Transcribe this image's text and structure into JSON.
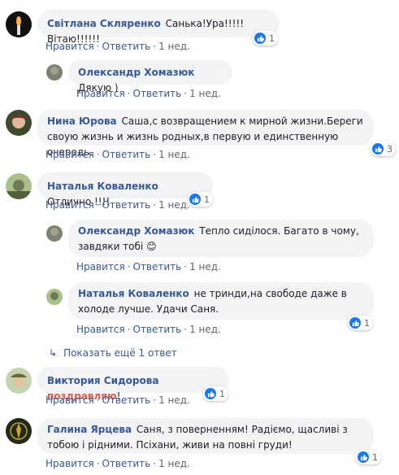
{
  "meta": {
    "like": "Нравится",
    "reply": "Ответить",
    "time": "1 нед."
  },
  "comments": [
    {
      "author": "Світлана Скляренко",
      "text": "Санька!Ура!!!!!Вітаю!!!!!!",
      "likes": "1"
    },
    {
      "author": "Олександр Хомазюк",
      "text": "Дякую )"
    },
    {
      "author": "Нина Юрова",
      "text": "Саша,с возвращением к мирной жизни.Береги своую жизнь и жизнь родных,в первую и единственную очередь.",
      "likes": "3"
    },
    {
      "author": "Наталья Коваленко",
      "text": "Отлично !!!!",
      "likes": "1"
    },
    {
      "author": "Олександр Хомазюк",
      "text": "Тепло сиділося. Багато в чому, завдяки тобі 😊"
    },
    {
      "author": "Наталья Коваленко",
      "text": "не тринди,на свободе даже в холоде лучше. Удачи Саня.",
      "likes": "1"
    },
    {
      "author": "Виктория Сидорова",
      "mention": "поздравляю",
      "text": "!",
      "likes": "1"
    },
    {
      "author": "Галина Ярцева",
      "text": "Саня, з поверненням! Радіємо, щасливі з тобою і рідними. Псіхани, живи на повні груди!",
      "likes": "1"
    }
  ],
  "more_replies": "Показать ещё 1 ответ"
}
